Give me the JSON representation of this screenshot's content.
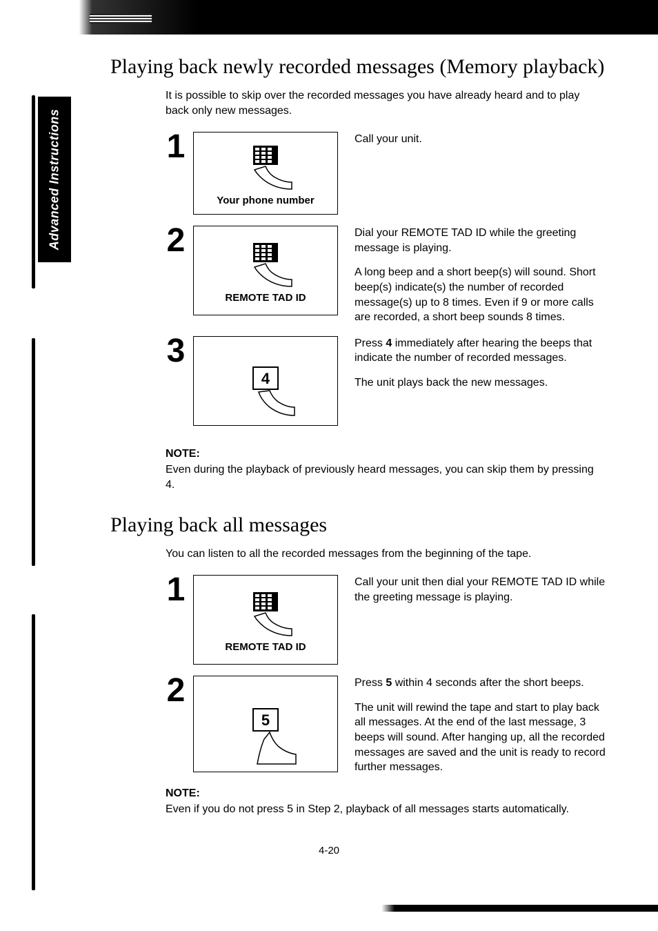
{
  "side_tab": "Advanced Instructions",
  "section1": {
    "title": "Playing back newly recorded messages (Memory playback)",
    "intro": "It is possible to skip over the recorded messages you have already heard and to play back only new messages.",
    "steps": [
      {
        "num": "1",
        "fig_caption": "Your phone number",
        "desc_paras": [
          "Call your unit."
        ]
      },
      {
        "num": "2",
        "fig_caption": "REMOTE TAD ID",
        "desc_paras": [
          "Dial your REMOTE TAD ID while the greeting message is playing.",
          "A long beep and a short beep(s) will sound. Short beep(s) indicate(s) the number of recorded message(s) up to 8 times. Even if 9 or more calls are recorded, a short beep sounds 8 times."
        ]
      },
      {
        "num": "3",
        "fig_key": "4",
        "desc_paras": [
          "Press 4 immediately after hearing the beeps that indicate the number of recorded messages.",
          "The unit plays back the new messages."
        ]
      }
    ],
    "note_label": "NOTE:",
    "note_text": "Even during the playback of previously heard messages, you can skip them by pressing 4."
  },
  "section2": {
    "title": "Playing back all messages",
    "intro": "You can listen to all the recorded messages from the beginning of the tape.",
    "steps": [
      {
        "num": "1",
        "fig_caption": "REMOTE TAD ID",
        "desc_paras": [
          "Call your unit then dial your REMOTE TAD ID while the greeting message is playing."
        ]
      },
      {
        "num": "2",
        "fig_key": "5",
        "desc_paras": [
          "Press 5 within 4 seconds after the short beeps.",
          "The unit will rewind the tape and start to play back all messages. At the end of the last message, 3 beeps will sound. After hanging up, all the recorded messages are saved and the unit is ready to record further messages."
        ]
      }
    ],
    "note_label": "NOTE:",
    "note_text": "Even if you do not press 5 in Step 2, playback of all messages starts automatically."
  },
  "page_number": "4-20"
}
